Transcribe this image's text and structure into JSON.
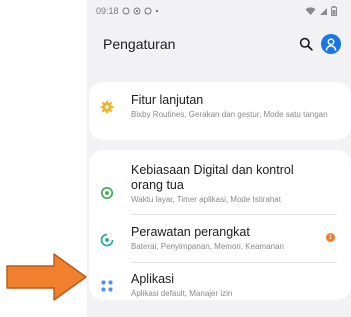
{
  "status_bar": {
    "time": "09:18",
    "indicators_left": [
      "circle-icon",
      "gallery-icon",
      "whatsapp-icon",
      "dot"
    ],
    "indicators_right": [
      "wifi-icon",
      "signal-icon",
      "battery-icon"
    ]
  },
  "header": {
    "title": "Pengaturan"
  },
  "settings": {
    "advanced": {
      "title": "Fitur lanjutan",
      "subtitle": "Bixby Routines, Gerakan dan gestur, Mode satu tangan",
      "icon": "gear-plus-icon"
    },
    "digital_wellbeing": {
      "title": "Kebiasaan Digital dan kontrol orang tua",
      "subtitle": "Waktu layar, Timer aplikasi, Mode Istirahat",
      "icon": "wellbeing-icon"
    },
    "device_care": {
      "title": "Perawatan perangkat",
      "subtitle": "Baterai, Penyimpanan, Memori, Keamanan",
      "icon": "device-care-icon",
      "badge": "1"
    },
    "apps": {
      "title": "Aplikasi",
      "subtitle": "Aplikasi default, Manajer izin",
      "icon": "apps-grid-icon"
    }
  },
  "colors": {
    "accent_blue": "#1976e3",
    "advanced_icon": "#f0b329",
    "wellbeing_icon": "#3cab54",
    "device_care_icon": "#23a89a",
    "apps_icon": "#4f8ef2",
    "badge": "#f07c24",
    "arrow": "#f07f2e"
  }
}
